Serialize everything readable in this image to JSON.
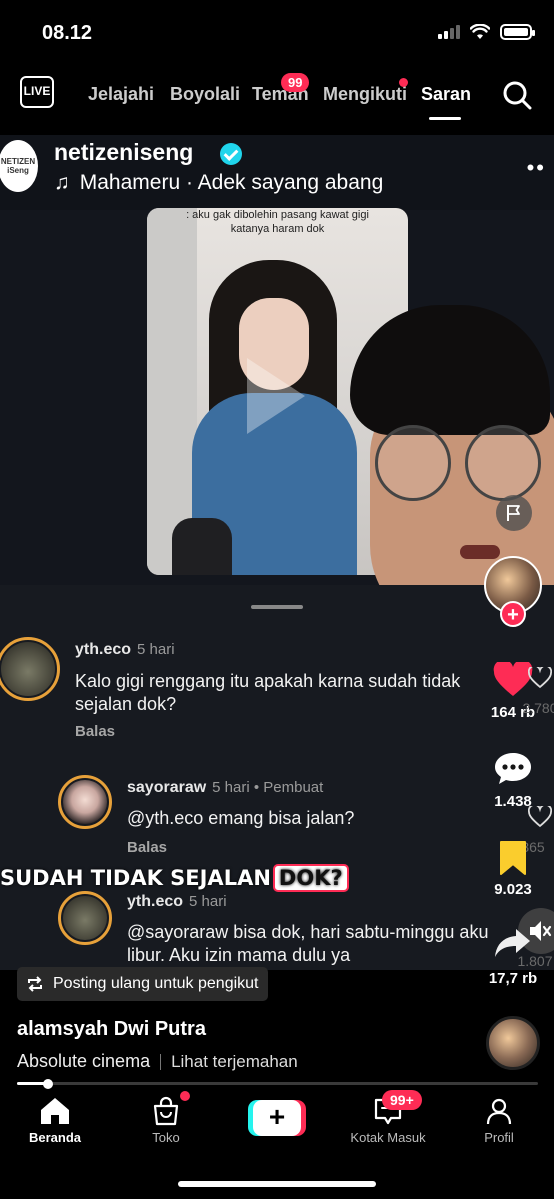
{
  "status_bar": {
    "time": "08.12"
  },
  "top_nav": {
    "tabs": [
      {
        "label": "Jelajahi"
      },
      {
        "label": "Boyolali"
      },
      {
        "label": "Teman"
      },
      {
        "label": "Mengikuti"
      },
      {
        "label": "Saran"
      }
    ],
    "teman_badge": "99",
    "active_tab": "Saran"
  },
  "post": {
    "account_name": "netizeniseng",
    "avatar_text": "NETIZEN iSeng",
    "music": "Mahameru · Adek sayang abang",
    "video_caption": ": aku gak dibolehin pasang kawat gigi katanya haram dok",
    "overlay_caption_plain": "SUDAH TIDAK SEJALAN",
    "overlay_caption_highlight": "DOK?"
  },
  "comments": [
    {
      "user": "yth.eco",
      "meta": "5 hari",
      "text": "Kalo gigi renggang itu apakah karna sudah tidak sejalan dok?",
      "reply_label": "Balas"
    },
    {
      "user": "sayoraraw",
      "meta": "5 hari • Pembuat",
      "text": "@yth.eco emang bisa jalan?",
      "reply_label": "Balas"
    },
    {
      "user": "yth.eco",
      "meta": "5 hari",
      "text": "@sayoraraw bisa dok, hari sabtu-minggu aku libur. Aku izin mama dulu ya"
    }
  ],
  "actions": {
    "likes": "164 rb",
    "comments": "1.438",
    "saves": "9.023",
    "shares": "17,7 rb",
    "ghost_likes": "2.780",
    "ghost_count_2": "365",
    "ghost_count_3": "1.807"
  },
  "repost_label": "Posting ulang untuk pengikut",
  "author": "alamsyah Dwi Putra",
  "description": "Absolute cinema",
  "translate_label": "Lihat terjemahan",
  "progress_fraction": 0.06,
  "bottom_nav": {
    "tabs": [
      {
        "label": "Beranda"
      },
      {
        "label": "Toko"
      },
      {
        "label": "Kotak Masuk"
      },
      {
        "label": "Profil"
      }
    ],
    "inbox_badge": "99+"
  },
  "colors": {
    "accent": "#fe2c55",
    "cyan": "#25f4ee",
    "save_yellow": "#facd2d",
    "verified": "#20d5ec"
  }
}
